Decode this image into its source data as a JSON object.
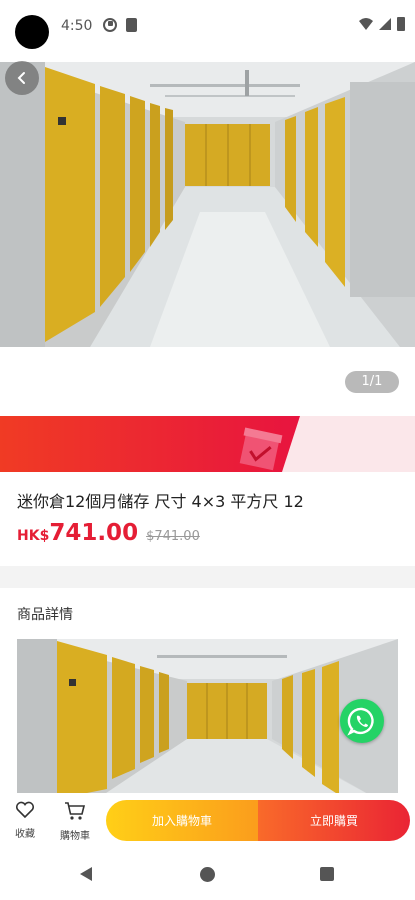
{
  "status_bar": {
    "time": "4:50",
    "icons": [
      "data-saver-icon",
      "sim-card-icon",
      "wifi-icon",
      "signal-icon",
      "battery-icon"
    ]
  },
  "gallery": {
    "counter": "1/1"
  },
  "product": {
    "title": "迷你倉12個月儲存 尺寸 4×3 平方尺 12",
    "currency": "HK$",
    "price": "741.00",
    "original_price": "$741.00"
  },
  "details": {
    "heading": "商品詳情"
  },
  "action_bar": {
    "favorite_label": "收藏",
    "cart_label": "購物車",
    "add_to_cart_label": "加入購物車",
    "buy_now_label": "立即購買"
  },
  "colors": {
    "price_red": "#e51e35",
    "add_cart_gradient": [
      "#ffcf17",
      "#fb9d1c"
    ],
    "buy_now_gradient": [
      "#f96a2a",
      "#ea2434"
    ],
    "whatsapp_green": "#25d366"
  }
}
